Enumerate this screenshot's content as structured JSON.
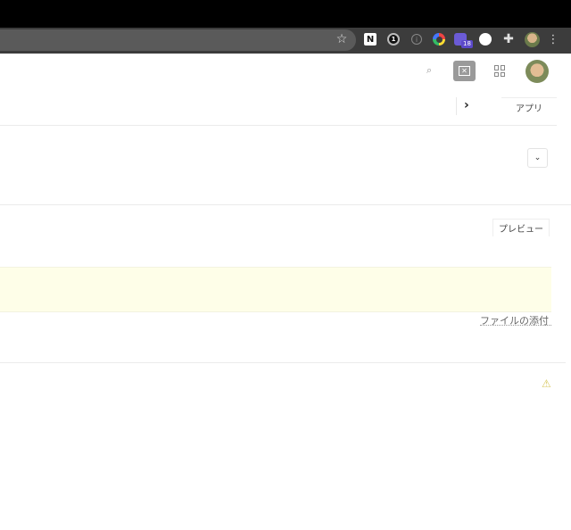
{
  "browser": {
    "extensions": [
      {
        "name": "notion",
        "glyph": "N"
      },
      {
        "name": "1password",
        "glyph": "1"
      },
      {
        "name": "info",
        "glyph": "i"
      },
      {
        "name": "color-picker"
      },
      {
        "name": "badge-extension",
        "badge": "18"
      },
      {
        "name": "github"
      },
      {
        "name": "extensions-puzzle",
        "glyph": "✚"
      }
    ],
    "star_glyph": "☆",
    "menu_glyph": "⋮"
  },
  "header": {
    "search_glyph": "⌕",
    "feedback_glyph": "✕"
  },
  "subnav": {
    "chevron_glyph": "›",
    "apps_label": "アプリ"
  },
  "form": {
    "dropdown_glyph": "⌄",
    "preview_label": "プレビュー",
    "attach_label": "ファイルの添付",
    "warning_glyph": "⚠"
  },
  "colors": {
    "editor_background": "#fefee8",
    "toolbar": "#3c3c3c",
    "badge": "#5b49c9"
  }
}
